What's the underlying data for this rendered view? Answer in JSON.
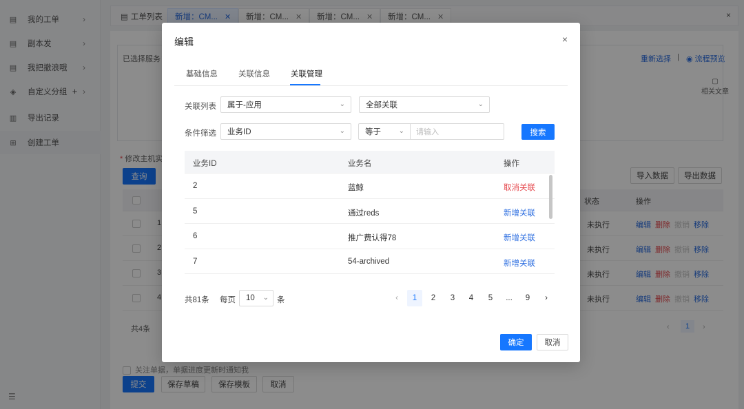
{
  "sidebar": {
    "items": [
      {
        "label": "我的工单",
        "icon": "document-icon",
        "has_chevron": true
      },
      {
        "label": "副本发",
        "icon": "document-icon",
        "has_chevron": true
      },
      {
        "label": "我把撤浪哦",
        "icon": "document-icon",
        "has_chevron": true
      },
      {
        "label": "自定义分组",
        "icon": "layers-icon",
        "has_chevron": true,
        "extra": "+"
      },
      {
        "label": "导出记录",
        "icon": "bar-chart-icon",
        "has_chevron": false
      },
      {
        "label": "创建工单",
        "icon": "plus-square-icon",
        "has_chevron": false
      }
    ],
    "collapse_icon": "collapse-icon"
  },
  "tabs": [
    {
      "label": "工单列表",
      "icon": "list-icon",
      "closable": false
    },
    {
      "label": "新增：CM...",
      "closable": true,
      "active": true
    },
    {
      "label": "新增：CM...",
      "closable": true
    },
    {
      "label": "新增：CM...",
      "closable": true
    },
    {
      "label": "新增：CM...",
      "closable": true
    }
  ],
  "tabs_close": "×",
  "main": {
    "selected_service_label": "已选择服务：",
    "reselect_link": "重新选择",
    "separator": "|",
    "flow_preview_link": "流程预览",
    "related_docs": "相关文章",
    "modify_host_label": "修改主机实",
    "query_button": "查询",
    "import_button": "导入数据",
    "export_button": "导出数据",
    "table_header_status": "状态",
    "table_header_action": "操作",
    "rows": [
      {
        "index": "1",
        "status": "未执行"
      },
      {
        "index": "2",
        "status": "未执行"
      },
      {
        "index": "3",
        "status": "未执行"
      },
      {
        "index": "4",
        "status": "未执行"
      }
    ],
    "row_actions": {
      "edit": "编辑",
      "delete": "删除",
      "disabled": "撤销",
      "remove": "移除"
    },
    "total": "共4条",
    "page_current": "1",
    "footer_note": "关注单据，单据进度更新时通知我",
    "submit_button": "提交",
    "save_draft_button": "保存草稿",
    "save_template_button": "保存模板",
    "cancel_button": "取消"
  },
  "modal": {
    "title": "编辑",
    "close": "×",
    "tabs": [
      {
        "label": "基础信息"
      },
      {
        "label": "关联信息"
      },
      {
        "label": "关联管理",
        "active": true
      }
    ],
    "relation_list_label": "关联列表",
    "relation_type_value": "属于-应用",
    "relation_scope_value": "全部关联",
    "filter_label": "条件筛选",
    "filter_field_value": "业务ID",
    "filter_op_value": "等于",
    "filter_input_placeholder": "请输入",
    "search_button": "搜索",
    "columns": [
      "业务ID",
      "业务名",
      "操作"
    ],
    "rows": [
      {
        "id": "2",
        "name": "蓝鲸",
        "action": "取消关联",
        "action_type": "danger"
      },
      {
        "id": "5",
        "name": "通过reds",
        "action": "新增关联",
        "action_type": "primary"
      },
      {
        "id": "6",
        "name": "推广费认得78",
        "action": "新增关联",
        "action_type": "primary"
      },
      {
        "id": "7",
        "name": "54-archived",
        "action": "新增关联",
        "action_type": "primary"
      }
    ],
    "pagination": {
      "total": "共81条",
      "per_page_label": "每页",
      "page_size": "10",
      "unit": "条",
      "prev": "‹",
      "pages": [
        "1",
        "2",
        "3",
        "4",
        "5",
        "...",
        "9"
      ],
      "current": "1",
      "next": "›"
    },
    "ok_button": "确定",
    "cancel_button": "取消"
  },
  "colors": {
    "primary": "#1677ff",
    "danger": "#e5484d",
    "link": "#2b6de0"
  }
}
